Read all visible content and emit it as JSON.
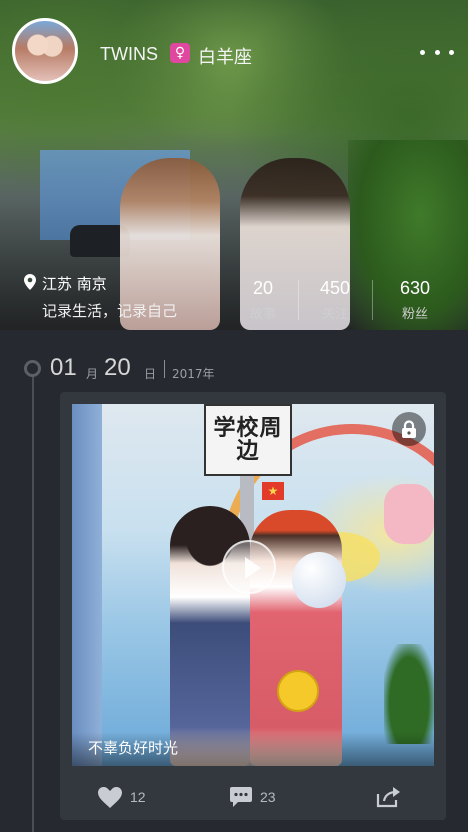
{
  "profile": {
    "nickname": "TWINS",
    "gender_icon": "female-icon",
    "zodiac": "白羊座",
    "location": "江苏 南京",
    "motto": "记录生活，记录自己"
  },
  "stats": [
    {
      "value": "20",
      "label": "故事"
    },
    {
      "value": "450",
      "label": "关注"
    },
    {
      "value": "630",
      "label": "粉丝"
    }
  ],
  "timeline": {
    "month": "01",
    "month_unit": "月",
    "day": "20",
    "day_unit": "日",
    "year": "2017年"
  },
  "post": {
    "sign_text": "学校周边",
    "caption": "不辜负好时光",
    "likes": "12",
    "comments": "23"
  },
  "colors": {
    "background": "#262a30",
    "card": "#33373e",
    "gender_badge": "#e0479e",
    "muted_text": "#b5b9c0"
  }
}
